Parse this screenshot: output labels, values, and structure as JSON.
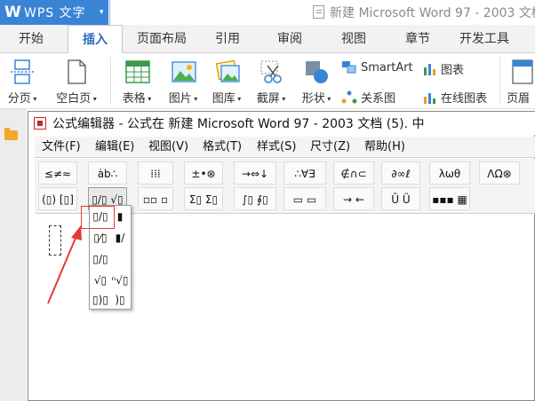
{
  "app": {
    "logo": "W",
    "name": "WPS 文字",
    "dropdown": "▾"
  },
  "document_title": "新建 Microsoft Word 97 - 2003 文档",
  "ribbon_tabs": [
    "开始",
    "插入",
    "页面布局",
    "引用",
    "审阅",
    "视图",
    "章节",
    "开发工具"
  ],
  "active_tab": "插入",
  "ribbon": {
    "page_break": "分页",
    "blank_page": "空白页",
    "table": "表格",
    "picture": "图片",
    "gallery": "图库",
    "screenshot": "截屏",
    "shapes": "形状",
    "smartart": "SmartArt",
    "chart": "图表",
    "relation_chart": "关系图",
    "online_chart": "在线图表",
    "header": "页眉"
  },
  "equation_editor": {
    "title": "公式编辑器 - 公式在 新建 Microsoft Word 97 - 2003 文档 (5). 中",
    "menus": [
      "文件(F)",
      "编辑(E)",
      "视图(V)",
      "格式(T)",
      "样式(S)",
      "尺寸(Z)",
      "帮助(H)"
    ],
    "toolbar_row1": [
      "≤≠≈",
      "ȧb∴",
      "⁞⁞⁞",
      "±•⊗",
      "→⇔↓",
      "∴∀∃",
      "∉∩⊂",
      "∂∞ℓ",
      "λωθ",
      "ΛΩ⊗"
    ],
    "toolbar_row2": [
      "(▯) [▯]",
      "▯/▯ √▯",
      "▫▫ ▫",
      "Σ▯ Σ▯",
      "∫▯ ∮▯",
      "▭ ▭",
      "→ ←",
      "Ū Ü",
      "▪▪▪ ▦"
    ],
    "fraction_popup": [
      "▯/▯",
      "▮",
      "▯⁄▯",
      "▮/",
      "▯/▯",
      "√▯",
      "ⁿ√▯",
      "▯)▯",
      ")▯"
    ]
  },
  "colors": {
    "accent": "#3a84d6",
    "active_tab_text": "#2b6cc6",
    "annotation_red": "#e23b3b"
  }
}
